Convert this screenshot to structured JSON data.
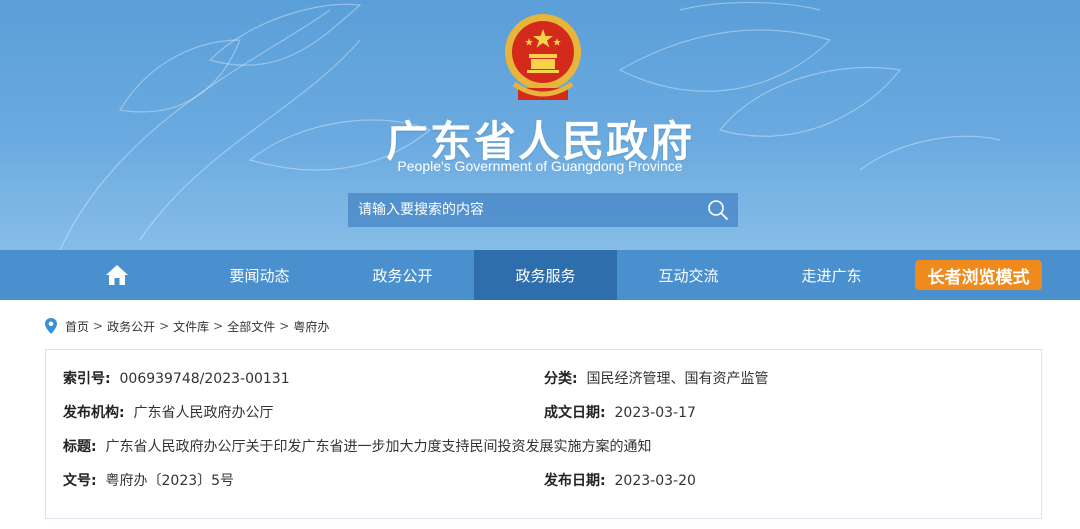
{
  "header": {
    "title": "广东省人民政府",
    "subtitle": "People's Government of Guangdong Province",
    "search_placeholder": "请输入要搜索的内容"
  },
  "nav": {
    "items": [
      {
        "label": "要闻动态"
      },
      {
        "label": "政务公开"
      },
      {
        "label": "政务服务",
        "active": true
      },
      {
        "label": "互动交流"
      },
      {
        "label": "走进广东"
      }
    ],
    "elder_mode": "长者浏览模式"
  },
  "breadcrumb": [
    "首页",
    "政务公开",
    "文件库",
    "全部文件",
    "粤府办"
  ],
  "info": {
    "index_label": "索引号:",
    "index_value": "006939748/2023-00131",
    "category_label": "分类:",
    "category_value": "国民经济管理、国有资产监管",
    "publisher_label": "发布机构:",
    "publisher_value": "广东省人民政府办公厅",
    "created_label": "成文日期:",
    "created_value": "2023-03-17",
    "title_label": "标题:",
    "title_value": "广东省人民政府办公厅关于印发广东省进一步加大力度支持民间投资发展实施方案的通知",
    "docno_label": "文号:",
    "docno_value": "粤府办〔2023〕5号",
    "pubdate_label": "发布日期:",
    "pubdate_value": "2023-03-20"
  },
  "colors": {
    "header_blue": "#5b9fd8",
    "nav_blue": "#4a90cf",
    "nav_active": "#2e6eac",
    "elder_orange": "#f08a1c"
  },
  "icons": {
    "home": "home-icon",
    "search": "search-icon",
    "location": "location-pin-icon",
    "emblem": "national-emblem-icon"
  }
}
